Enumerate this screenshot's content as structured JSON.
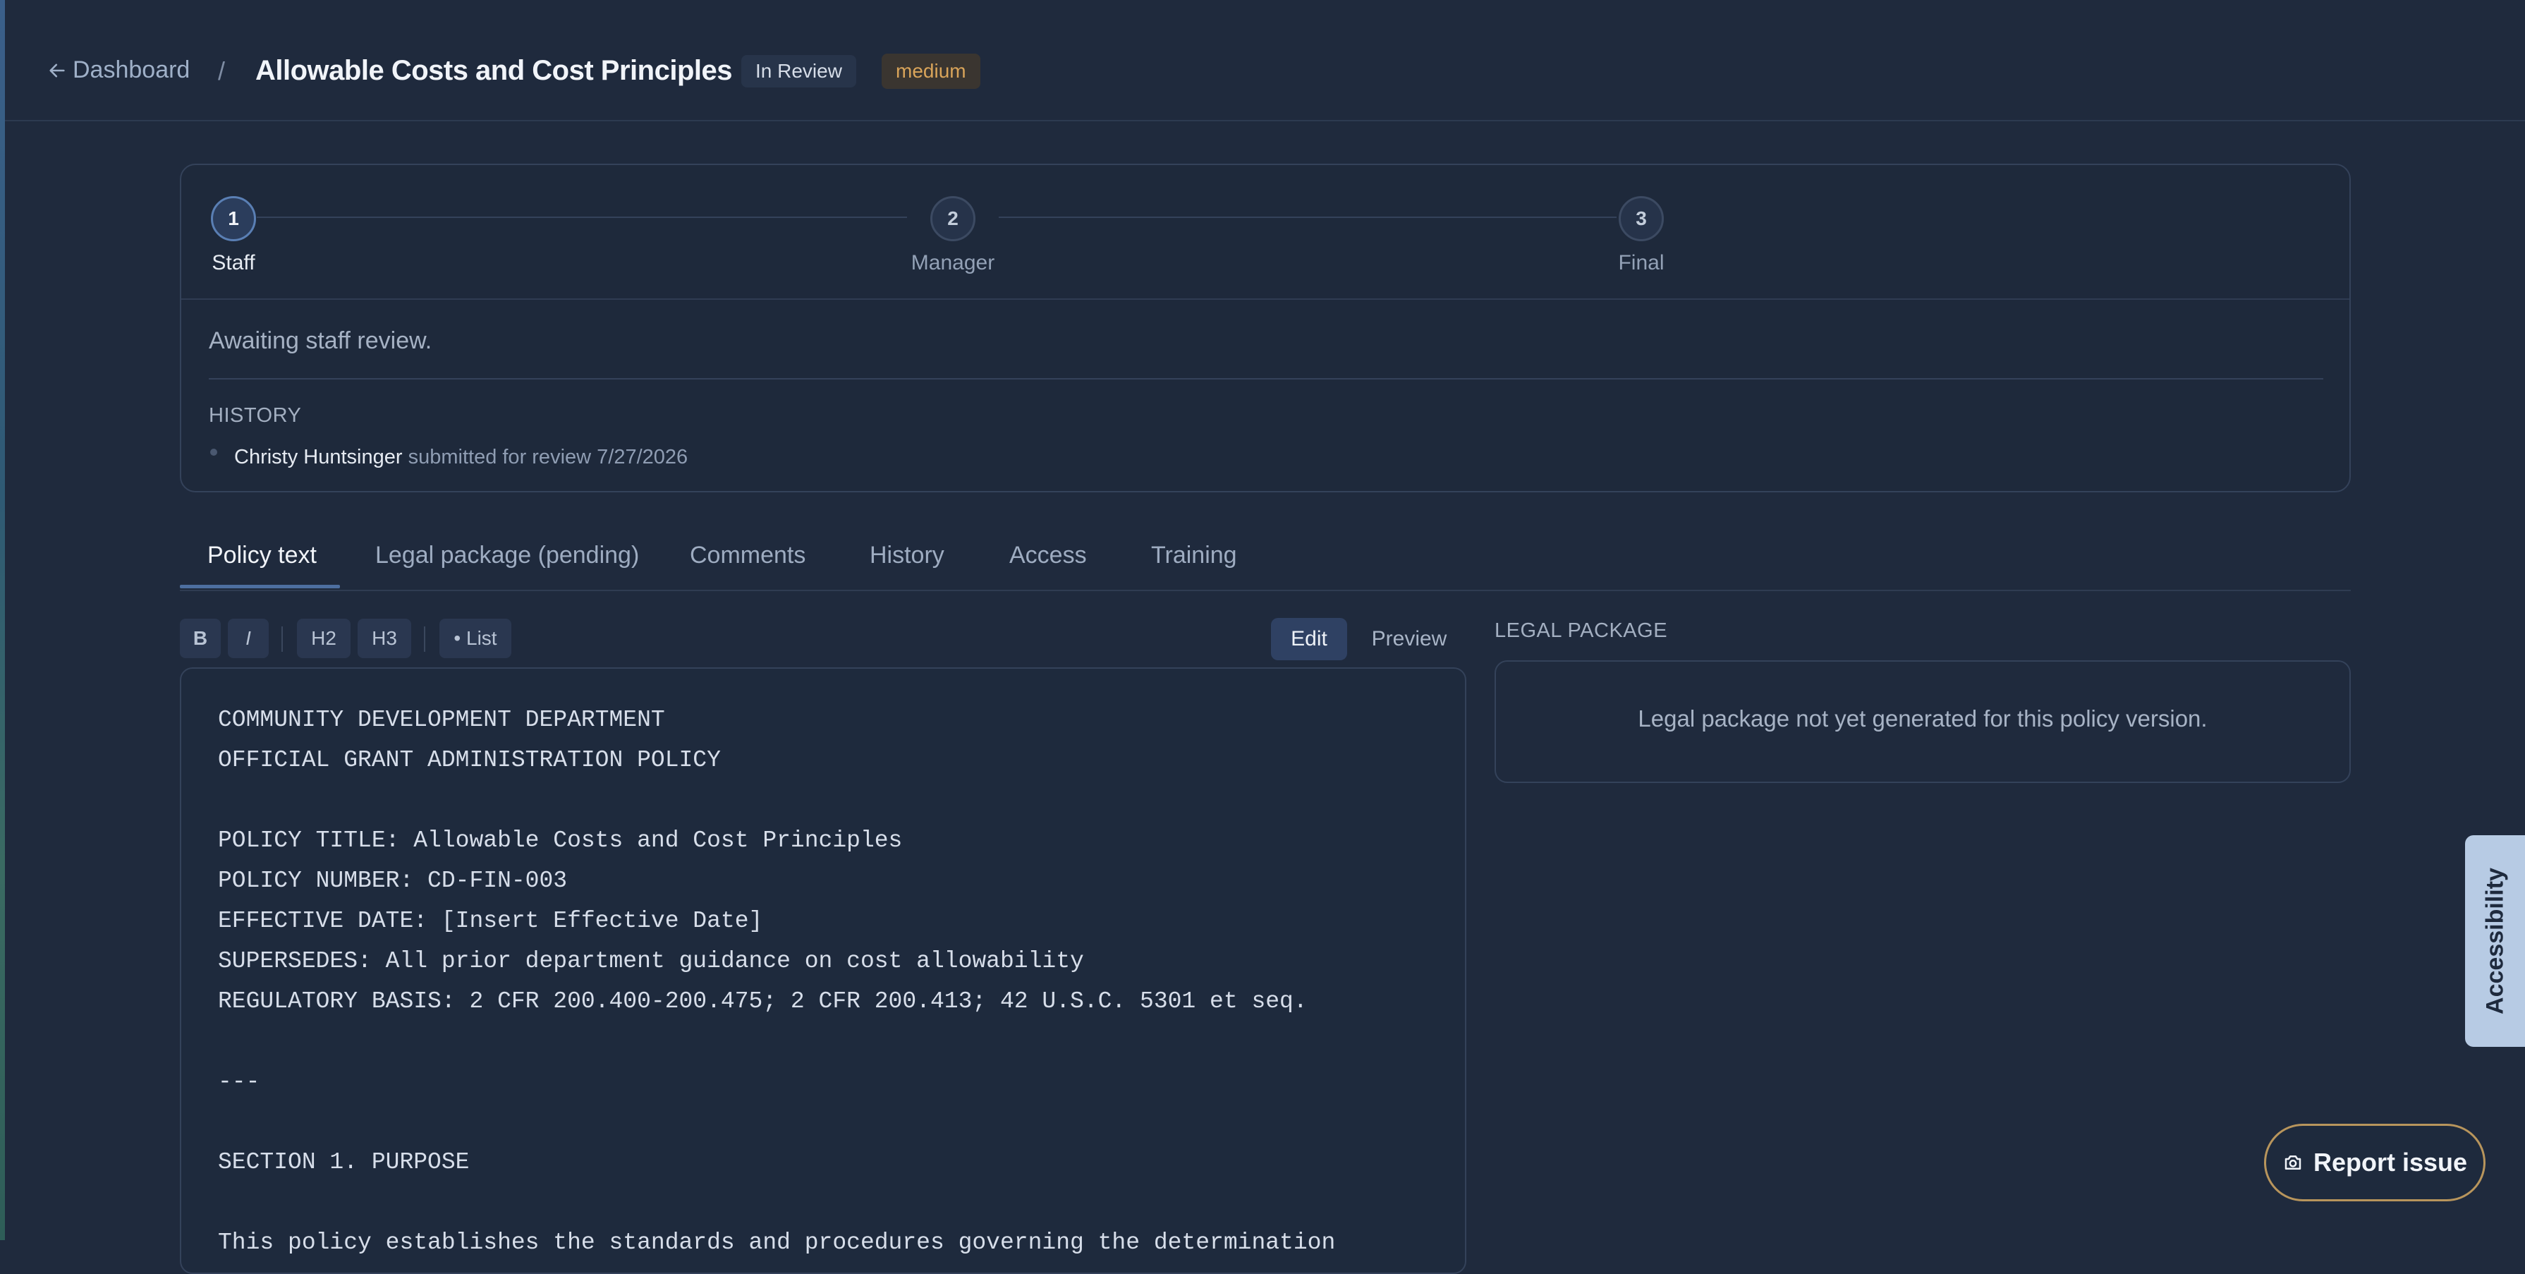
{
  "header": {
    "back_label": "Dashboard",
    "separator": "/",
    "title": "Allowable Costs and Cost Principles",
    "status": "In Review",
    "priority": "medium"
  },
  "review": {
    "steps": [
      {
        "number": "1",
        "label": "Staff"
      },
      {
        "number": "2",
        "label": "Manager"
      },
      {
        "number": "3",
        "label": "Final"
      }
    ],
    "active_step": 1,
    "message": "Awaiting staff review.",
    "history_heading": "HISTORY",
    "history": [
      {
        "who": "Christy Huntsinger",
        "action": "submitted for review 7/27/2026"
      }
    ]
  },
  "tabs": [
    {
      "label": "Policy text"
    },
    {
      "label": "Legal package (pending)"
    },
    {
      "label": "Comments"
    },
    {
      "label": "History"
    },
    {
      "label": "Access"
    },
    {
      "label": "Training"
    }
  ],
  "active_tab": "Policy text",
  "toolbar": {
    "bold": "B",
    "italic": "I",
    "h2": "H2",
    "h3": "H3",
    "list": "• List",
    "edit": "Edit",
    "preview": "Preview"
  },
  "editor": {
    "text": "COMMUNITY DEVELOPMENT DEPARTMENT\nOFFICIAL GRANT ADMINISTRATION POLICY\n\nPOLICY TITLE: Allowable Costs and Cost Principles\nPOLICY NUMBER: CD-FIN-003\nEFFECTIVE DATE: [Insert Effective Date]\nSUPERSEDES: All prior department guidance on cost allowability\nREGULATORY BASIS: 2 CFR 200.400-200.475; 2 CFR 200.413; 42 U.S.C. 5301 et seq.\n\n---\n\nSECTION 1. PURPOSE\n\nThis policy establishes the standards and procedures governing the determination"
  },
  "legal": {
    "heading": "LEGAL PACKAGE",
    "message": "Legal package not yet generated for this policy version."
  },
  "accessibility_label": "Accessibility",
  "report_issue_label": "Report issue",
  "colors": {
    "background": "#1f2a3d",
    "accent": "#4d6fa0",
    "priority": "#d9a45a",
    "report_border": "#b8955c",
    "accessibility_tab": "#b7cbe4"
  },
  "icons": {
    "back": "arrow-left-icon",
    "report": "camera-icon"
  }
}
